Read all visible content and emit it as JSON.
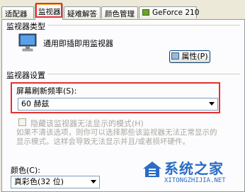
{
  "tabs": [
    {
      "label": "适配器"
    },
    {
      "label": "监视器"
    },
    {
      "label": "疑难解答"
    },
    {
      "label": "颜色管理"
    },
    {
      "label": "GeForce 210"
    }
  ],
  "monitor_type": {
    "group_title": "监视器类型",
    "name": "通用即插即用监视器",
    "properties_label": "属性(P)"
  },
  "monitor_settings": {
    "group_title": "监视器设置",
    "refresh_label": "屏幕刷新频率(S):",
    "refresh_value": "60 赫兹",
    "hide_modes_label": "隐藏该监视器无法显示的模式(H)",
    "description_line1": "如果不清该选项，则你可以选择那些该监视器无法正常显示的",
    "description_line2": "显示模式。这样会导致无法显示并且/或者损坏硬件。"
  },
  "colors": {
    "label": "颜色(C):",
    "value": "真彩色(32 位)"
  },
  "watermark": {
    "title": "系统之家",
    "url": "XITONGZHIJIA.NET"
  }
}
